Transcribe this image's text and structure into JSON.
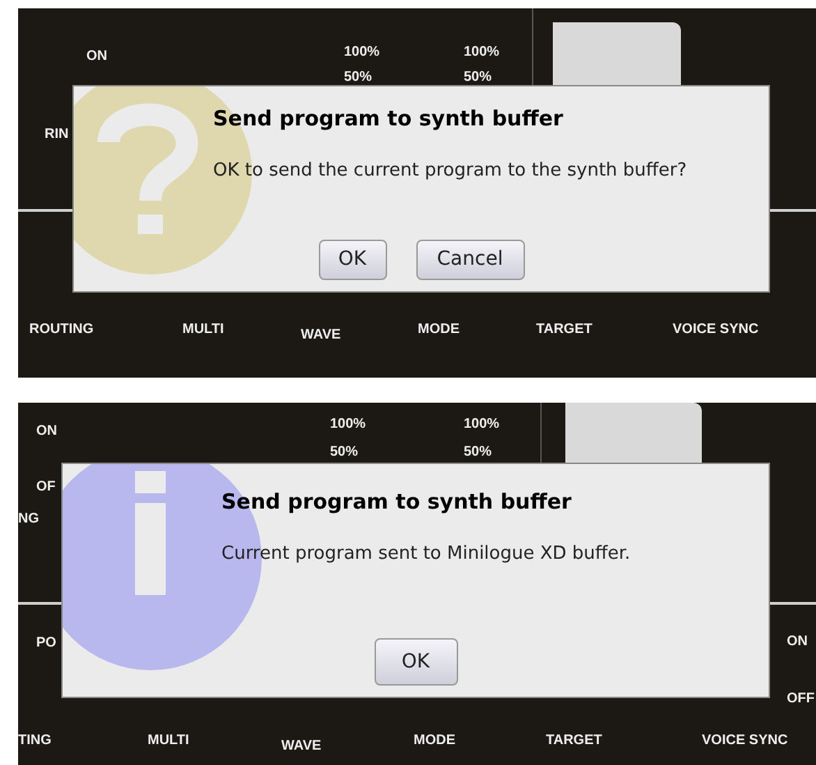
{
  "panels": [
    {
      "labels": [
        {
          "text": "ON"
        },
        {
          "text": "RIN"
        },
        {
          "text": "100%"
        },
        {
          "text": "50%"
        },
        {
          "text": "100%"
        },
        {
          "text": "50%"
        },
        {
          "text": "ROUTING"
        },
        {
          "text": "MULTI"
        },
        {
          "text": "WAVE"
        },
        {
          "text": "MODE"
        },
        {
          "text": "TARGET"
        },
        {
          "text": "VOICE SYNC"
        }
      ],
      "dialog": {
        "kind": "question",
        "title": "Send program to synth buffer",
        "message": "OK to send the current program to the synth buffer?",
        "buttons": [
          "OK",
          "Cancel"
        ]
      }
    },
    {
      "labels": [
        {
          "text": "ON"
        },
        {
          "text": "OF"
        },
        {
          "text": "NG"
        },
        {
          "text": "100%"
        },
        {
          "text": "50%"
        },
        {
          "text": "100%"
        },
        {
          "text": "50%"
        },
        {
          "text": "PO"
        },
        {
          "text": "ON"
        },
        {
          "text": "OFF"
        },
        {
          "text": "TING"
        },
        {
          "text": "MULTI"
        },
        {
          "text": "WAVE"
        },
        {
          "text": "MODE"
        },
        {
          "text": "TARGET"
        },
        {
          "text": "VOICE SYNC"
        }
      ],
      "dialog": {
        "kind": "info",
        "title": "Send program to synth buffer",
        "message": "Current program sent to Minilogue XD buffer.",
        "buttons": [
          "OK"
        ]
      }
    }
  ]
}
